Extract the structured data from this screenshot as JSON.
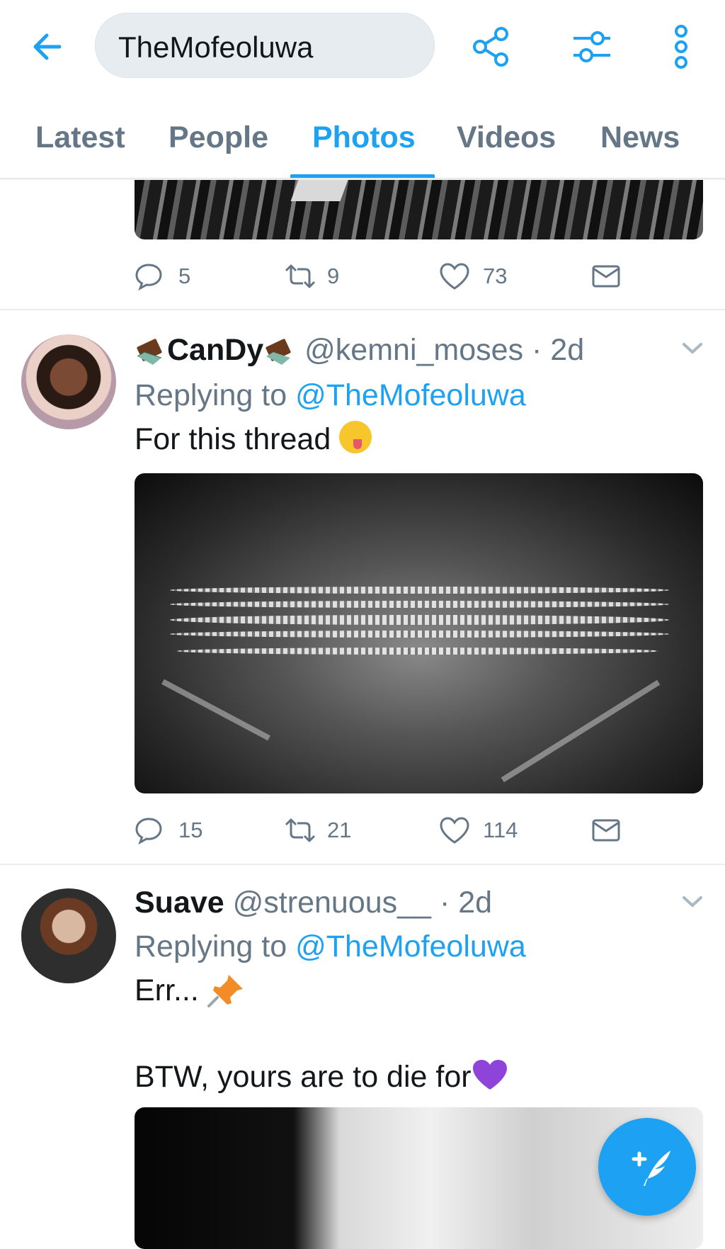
{
  "search": {
    "query": "TheMofeoluwa"
  },
  "tabs": [
    {
      "label": "Latest"
    },
    {
      "label": "People"
    },
    {
      "label": "Photos"
    },
    {
      "label": "Videos"
    },
    {
      "label": "News"
    }
  ],
  "tweets": [
    {
      "actions": {
        "replies": "5",
        "retweets": "9",
        "likes": "73"
      }
    },
    {
      "name": "CanDy",
      "handle": "@kemni_moses",
      "time": "· 2d",
      "replying_prefix": "Replying to",
      "replying_to": "@TheMofeoluwa",
      "text": "For this thread",
      "actions": {
        "replies": "15",
        "retweets": "21",
        "likes": "114"
      }
    },
    {
      "name": "Suave",
      "handle": "@strenuous__",
      "time": "· 2d",
      "replying_prefix": "Replying to",
      "replying_to": "@TheMofeoluwa",
      "text_line1": "Err...",
      "text_line2": "BTW, yours are to die for"
    }
  ],
  "colors": {
    "accent": "#1da1f2",
    "muted": "#657786",
    "text": "#14171a"
  },
  "icons": {
    "back": "arrow-left-icon",
    "share": "share-icon",
    "filter": "filter-sliders-icon",
    "more": "more-vertical-icon",
    "reply": "reply-bubble-icon",
    "retweet": "retweet-icon",
    "like": "heart-icon",
    "dm": "envelope-icon",
    "compose": "compose-tweet-icon"
  }
}
